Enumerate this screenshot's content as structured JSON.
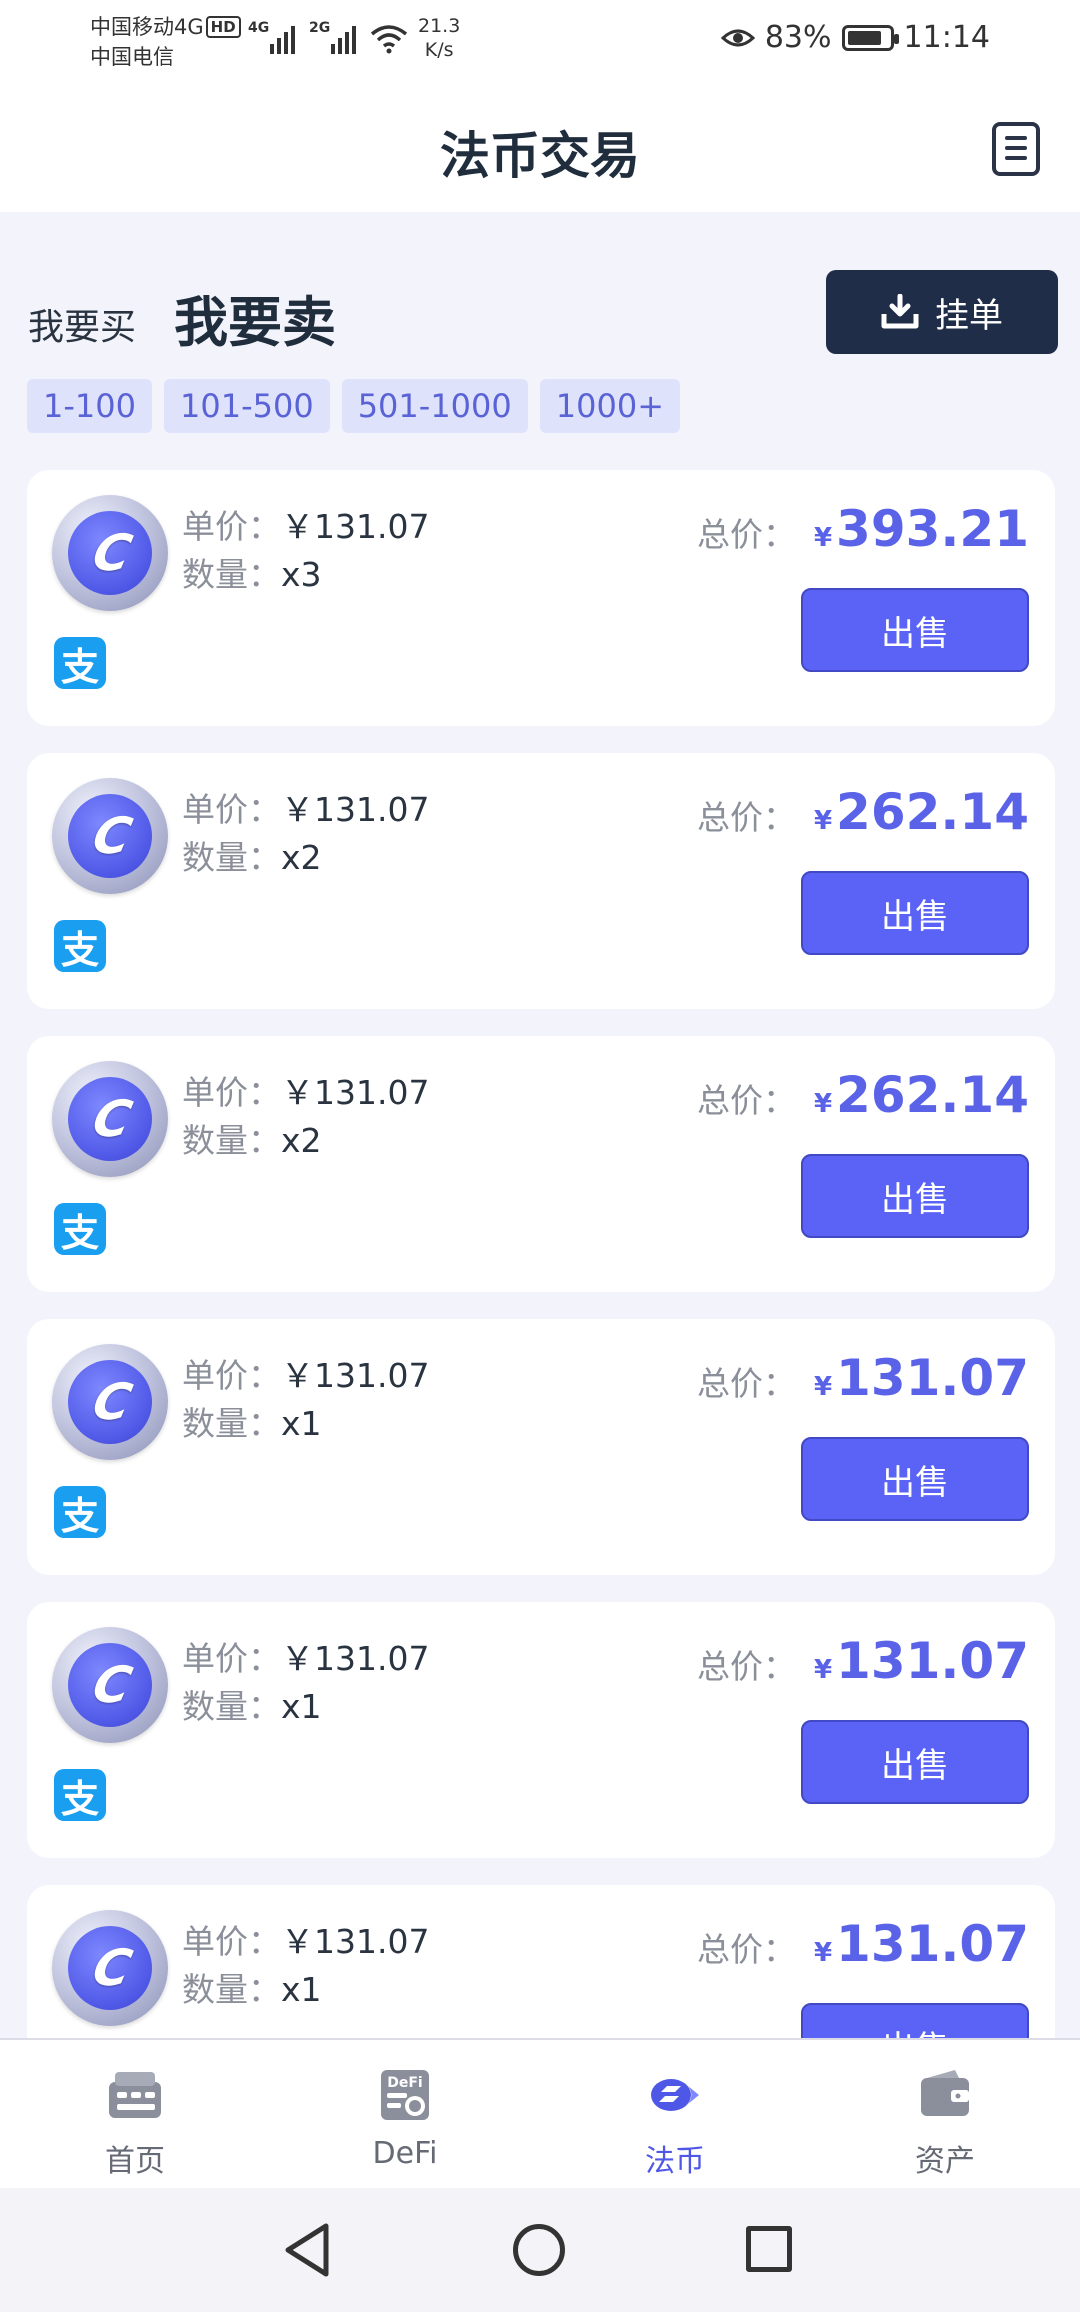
{
  "status_bar": {
    "carrier1": "中国移动4G",
    "hd": "HD",
    "carrier2": "中国电信",
    "sig1_tag": "4G",
    "sig2_tag": "2G",
    "speed_value": "21.3",
    "speed_unit": "K/s",
    "battery": "83%",
    "battery_level": 0.83,
    "time": "11:14"
  },
  "header": {
    "title": "法币交易",
    "menu_icon": "document-list-icon"
  },
  "mode": {
    "buy_label": "我要买",
    "sell_label": "我要卖",
    "post_button": "挂单"
  },
  "filters": [
    "1-100",
    "101-500",
    "501-1000",
    "1000+"
  ],
  "labels": {
    "unit_price": "单价：",
    "quantity": "数量：",
    "total": "总价：",
    "currency": "¥",
    "sell_button": "出售",
    "coin_glyph": "C",
    "payment_glyph": "支"
  },
  "orders": [
    {
      "price": "￥131.07",
      "qty": "x3",
      "total": "393.21"
    },
    {
      "price": "￥131.07",
      "qty": "x2",
      "total": "262.14"
    },
    {
      "price": "￥131.07",
      "qty": "x2",
      "total": "262.14"
    },
    {
      "price": "￥131.07",
      "qty": "x1",
      "total": "131.07"
    },
    {
      "price": "￥131.07",
      "qty": "x1",
      "total": "131.07"
    },
    {
      "price": "￥131.07",
      "qty": "x1",
      "total": "131.07"
    }
  ],
  "bottom_nav": {
    "items": [
      {
        "label": "首页",
        "icon": "home-icon"
      },
      {
        "label": "DeFi",
        "icon": "defi-icon",
        "icon_text": "DeFi"
      },
      {
        "label": "法币",
        "icon": "fiat-icon"
      },
      {
        "label": "资产",
        "icon": "wallet-icon"
      }
    ],
    "active_index": 2
  },
  "colors": {
    "accent": "#5a63f5",
    "dark_button": "#1f2d48",
    "alipay": "#1a9ff0",
    "chip_bg": "#dfe2fb"
  }
}
